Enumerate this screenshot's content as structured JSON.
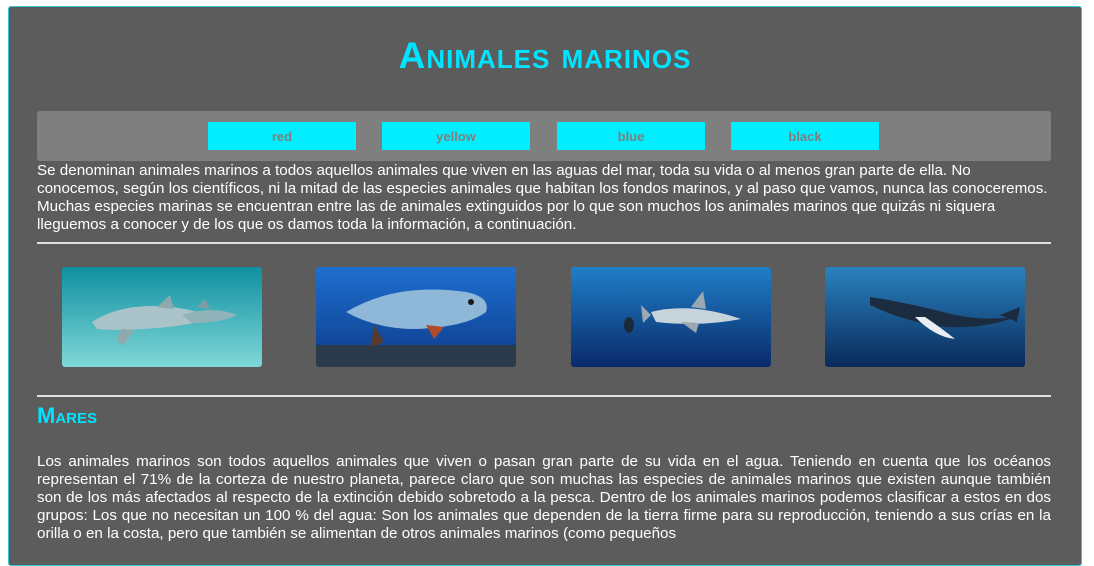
{
  "header": {
    "title": "Animales marinos"
  },
  "color_buttons": [
    {
      "label": "red"
    },
    {
      "label": "yellow"
    },
    {
      "label": "blue"
    },
    {
      "label": "black"
    }
  ],
  "intro": "Se denominan animales marinos a todos aquellos animales que viven en las aguas del mar, toda su vida o al menos gran parte de ella. No conocemos, según los científicos, ni la mitad de las especies animales que habitan los fondos marinos, y al paso que vamos, nunca las conoceremos. Muchas especies marinas se encuentran entre las de animales extinguidos por lo que son muchos los animales marinos que quizás ni siquera lleguemos a conocer y de los que os damos toda la información, a continuación.",
  "gallery": [
    {
      "icon": "dolphin-image"
    },
    {
      "icon": "seal-image"
    },
    {
      "icon": "shark-image"
    },
    {
      "icon": "whale-image"
    }
  ],
  "section": {
    "title": "Mares",
    "body": "Los animales marinos son todos aquellos animales que viven o pasan gran parte de su vida en el agua. Teniendo en cuenta que los océanos representan el 71% de la corteza de nuestro planeta, parece claro que son muchas las especies de animales marinos que existen aunque también son de los más afectados al respecto de la extinción debido sobretodo a la pesca. Dentro de los animales marinos podemos clasificar a estos en dos grupos: Los que no necesitan un 100 % del agua: Son los animales que dependen de la tierra firme para su reproducción, teniendo a sus crías en la orilla o en la costa, pero que también se alimentan de otros animales marinos (como pequeños"
  },
  "colors": {
    "background": "#5c5c5c",
    "accent": "#00e5ff",
    "button": "#00eeff",
    "bar": "#7f7f7f"
  }
}
